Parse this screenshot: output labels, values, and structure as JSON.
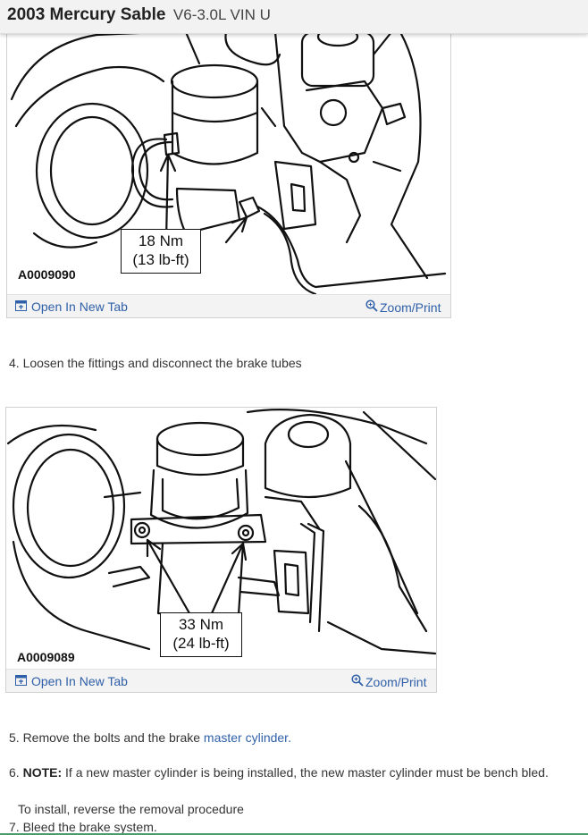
{
  "header": {
    "title": "2003 Mercury Sable",
    "subtitle": "V6-3.0L VIN U"
  },
  "figures": [
    {
      "code": "A0009090",
      "torque_line1": "18 Nm",
      "torque_line2": "(13 lb-ft)",
      "open_label": "Open In New Tab",
      "zoom_label": "Zoom/Print"
    },
    {
      "code": "A0009089",
      "torque_line1": "33 Nm",
      "torque_line2": "(24 lb-ft)",
      "open_label": "Open In New Tab",
      "zoom_label": "Zoom/Print"
    }
  ],
  "steps": {
    "s4": "4. Loosen the fittings and disconnect the brake tubes",
    "s5_prefix": "5. Remove the bolts and the brake ",
    "s5_link": "master cylinder.",
    "s6_prefix": "6. ",
    "s6_note": "NOTE:",
    "s6_text": " If a new master cylinder is being installed, the new master cylinder must be bench bled.",
    "install": "To install, reverse the removal procedure",
    "s7": "7. Bleed the brake system."
  },
  "colors": {
    "link": "#2f5fa8",
    "toolbar_bg": "#f3f3f3",
    "accent_line": "#4b9a6a"
  },
  "icons": {
    "open": "open-new-tab-icon",
    "zoom": "zoom-icon"
  }
}
